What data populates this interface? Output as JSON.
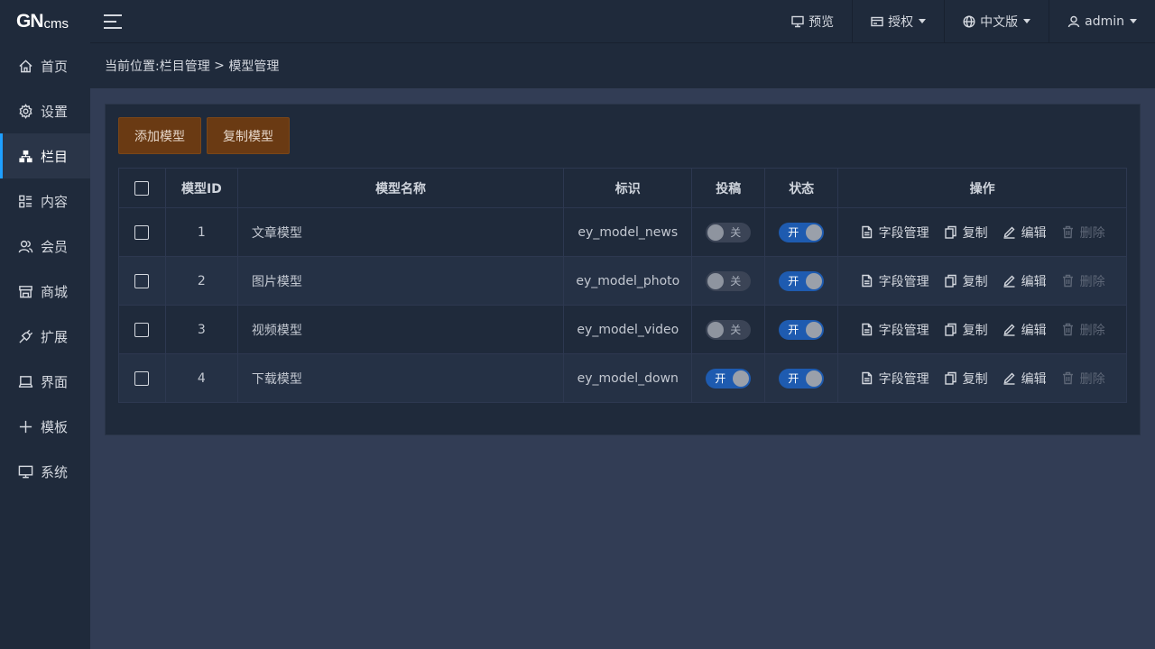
{
  "logo": {
    "big": "GN",
    "small": "cms"
  },
  "sidebar": {
    "items": [
      {
        "label": "首页",
        "icon": "home-icon"
      },
      {
        "label": "设置",
        "icon": "gear-icon"
      },
      {
        "label": "栏目",
        "icon": "sitemap-icon",
        "active": true
      },
      {
        "label": "内容",
        "icon": "list-icon"
      },
      {
        "label": "会员",
        "icon": "users-icon"
      },
      {
        "label": "商城",
        "icon": "shop-icon"
      },
      {
        "label": "扩展",
        "icon": "plug-icon"
      },
      {
        "label": "界面",
        "icon": "laptop-icon"
      },
      {
        "label": "模板",
        "icon": "plus-icon"
      },
      {
        "label": "系统",
        "icon": "monitor-icon"
      }
    ]
  },
  "topbar": {
    "preview": "预览",
    "license": "授权",
    "language": "中文版",
    "user": "admin"
  },
  "breadcrumb": {
    "prefix": "当前位置:",
    "level1": "栏目管理",
    "separator": " > ",
    "level2": "模型管理"
  },
  "toolbar": {
    "add": "添加模型",
    "copy": "复制模型"
  },
  "table": {
    "headers": {
      "id": "模型ID",
      "name": "模型名称",
      "key": "标识",
      "submit": "投稿",
      "status": "状态",
      "ops": "操作"
    },
    "ops": {
      "fields": "字段管理",
      "copy": "复制",
      "edit": "编辑",
      "delete": "删除"
    },
    "rows": [
      {
        "id": "1",
        "name": "文章模型",
        "key": "ey_model_news",
        "submit": "关",
        "status": "开"
      },
      {
        "id": "2",
        "name": "图片模型",
        "key": "ey_model_photo",
        "submit": "关",
        "status": "开"
      },
      {
        "id": "3",
        "name": "视频模型",
        "key": "ey_model_video",
        "submit": "关",
        "status": "开"
      },
      {
        "id": "4",
        "name": "下载模型",
        "key": "ey_model_down",
        "submit": "开",
        "status": "开"
      }
    ]
  },
  "colors": {
    "accent": "#1e9fff",
    "button": "#6a3a13",
    "switch_on": "#1e5bb0"
  }
}
